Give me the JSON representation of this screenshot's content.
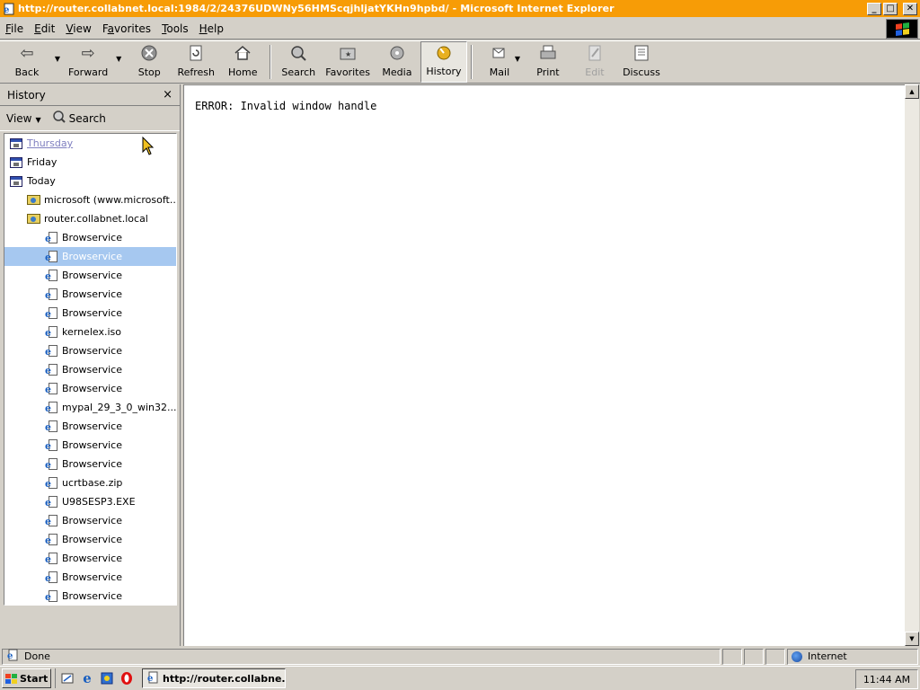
{
  "window": {
    "title": "http://router.collabnet.local:1984/2/24376UDWNy56HMScqjhljatYKHn9hpbd/ - Microsoft Internet Explorer",
    "controls": {
      "minimize": "_",
      "maximize": "□",
      "close": "✕"
    }
  },
  "menu": {
    "file": {
      "u": "F",
      "rest": "ile"
    },
    "edit": {
      "u": "E",
      "rest": "dit"
    },
    "view": {
      "u": "V",
      "rest": "iew"
    },
    "favorites": {
      "pre": "F",
      "u": "a",
      "rest": "vorites"
    },
    "tools": {
      "u": "T",
      "rest": "ools"
    },
    "help": {
      "u": "H",
      "rest": "elp"
    }
  },
  "toolbar": {
    "back": "Back",
    "forward": "Forward",
    "stop": "Stop",
    "refresh": "Refresh",
    "home": "Home",
    "search": "Search",
    "favorites": "Favorites",
    "media": "Media",
    "history": "History",
    "mail": "Mail",
    "print": "Print",
    "edit": "Edit",
    "discuss": "Discuss"
  },
  "sidebar": {
    "title": "History",
    "close": "×",
    "view_label": "View",
    "search_label": "Search",
    "items": [
      {
        "label": "Thursday",
        "level": 0,
        "icon": "calendar-icon",
        "state": "link"
      },
      {
        "label": "Friday",
        "level": 0,
        "icon": "calendar-icon",
        "state": ""
      },
      {
        "label": "Today",
        "level": 0,
        "icon": "calendar-icon",
        "state": ""
      },
      {
        "label": "microsoft (www.microsoft....",
        "level": 1,
        "icon": "folder-icon",
        "state": ""
      },
      {
        "label": "router.collabnet.local",
        "level": 1,
        "icon": "folder-icon",
        "state": ""
      },
      {
        "label": "Browservice",
        "level": 2,
        "icon": "page-icon",
        "state": ""
      },
      {
        "label": "Browservice",
        "level": 2,
        "icon": "page-icon",
        "state": "selected"
      },
      {
        "label": "Browservice",
        "level": 2,
        "icon": "page-icon",
        "state": ""
      },
      {
        "label": "Browservice",
        "level": 2,
        "icon": "page-icon",
        "state": ""
      },
      {
        "label": "Browservice",
        "level": 2,
        "icon": "page-icon",
        "state": ""
      },
      {
        "label": "kernelex.iso",
        "level": 2,
        "icon": "page-icon",
        "state": ""
      },
      {
        "label": "Browservice",
        "level": 2,
        "icon": "page-icon",
        "state": ""
      },
      {
        "label": "Browservice",
        "level": 2,
        "icon": "page-icon",
        "state": ""
      },
      {
        "label": "Browservice",
        "level": 2,
        "icon": "page-icon",
        "state": ""
      },
      {
        "label": "mypal_29_3_0_win32...",
        "level": 2,
        "icon": "page-icon",
        "state": ""
      },
      {
        "label": "Browservice",
        "level": 2,
        "icon": "page-icon",
        "state": ""
      },
      {
        "label": "Browservice",
        "level": 2,
        "icon": "page-icon",
        "state": ""
      },
      {
        "label": "Browservice",
        "level": 2,
        "icon": "page-icon",
        "state": ""
      },
      {
        "label": "ucrtbase.zip",
        "level": 2,
        "icon": "page-icon",
        "state": ""
      },
      {
        "label": "U98SESP3.EXE",
        "level": 2,
        "icon": "page-icon",
        "state": ""
      },
      {
        "label": "Browservice",
        "level": 2,
        "icon": "page-icon",
        "state": ""
      },
      {
        "label": "Browservice",
        "level": 2,
        "icon": "page-icon",
        "state": ""
      },
      {
        "label": "Browservice",
        "level": 2,
        "icon": "page-icon",
        "state": ""
      },
      {
        "label": "Browservice",
        "level": 2,
        "icon": "page-icon",
        "state": ""
      },
      {
        "label": "Browservice",
        "level": 2,
        "icon": "page-icon",
        "state": ""
      }
    ]
  },
  "content": {
    "message": "ERROR: Invalid window handle"
  },
  "status": {
    "text": "Done",
    "zone": "Internet"
  },
  "taskbar": {
    "start": "Start",
    "task_title": "http://router.collabne...",
    "clock": "11:44 AM"
  },
  "colors": {
    "titlebar": "#f79c06",
    "selection": "#a6c8f0",
    "chrome": "#d4d0c8"
  }
}
